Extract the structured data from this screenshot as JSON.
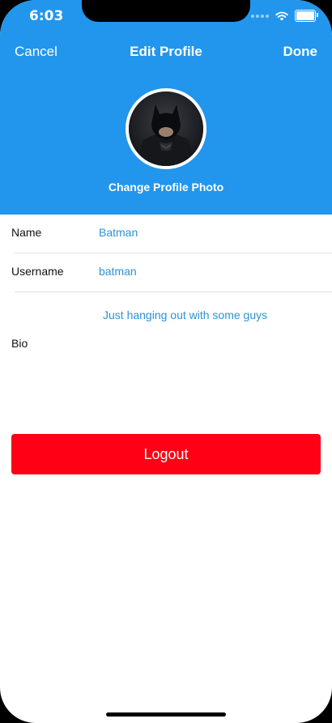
{
  "status_bar": {
    "time": "6:03",
    "icons": [
      "signal-dots-icon",
      "wifi-icon",
      "battery-icon"
    ]
  },
  "nav": {
    "cancel_label": "Cancel",
    "title": "Edit Profile",
    "done_label": "Done"
  },
  "profile_photo": {
    "change_label": "Change Profile Photo"
  },
  "fields": {
    "name_label": "Name",
    "name_value": "Batman",
    "username_label": "Username",
    "username_value": "batman",
    "bio_label": "Bio",
    "bio_value": "Just hanging out with some guys"
  },
  "logout_label": "Logout",
  "colors": {
    "header": "#2196ec",
    "accent_text": "#2b93d6",
    "logout": "#ff0014"
  }
}
